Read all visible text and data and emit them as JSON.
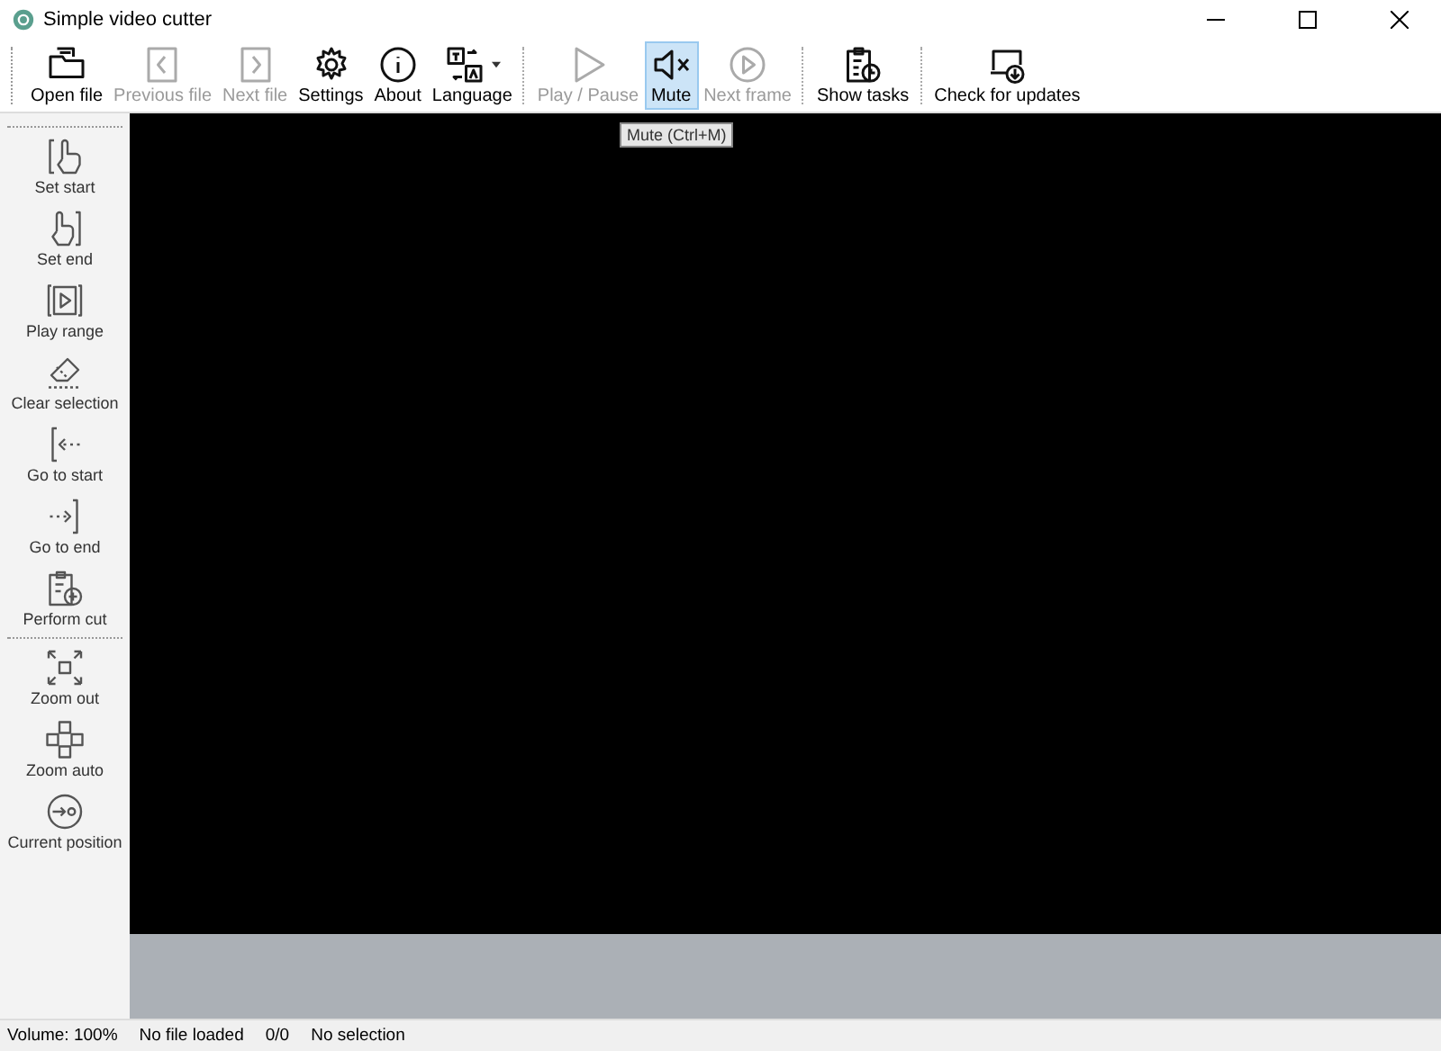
{
  "window": {
    "title": "Simple video cutter"
  },
  "toolbar": {
    "groups": [
      [
        {
          "label": "Open file",
          "kind": "open",
          "disabled": false,
          "selected": false
        },
        {
          "label": "Previous file",
          "kind": "prev",
          "disabled": true,
          "selected": false
        },
        {
          "label": "Next file",
          "kind": "next",
          "disabled": true,
          "selected": false
        },
        {
          "label": "Settings",
          "kind": "gear",
          "disabled": false,
          "selected": false
        },
        {
          "label": "About",
          "kind": "info",
          "disabled": false,
          "selected": false
        },
        {
          "label": "Language",
          "kind": "lang",
          "disabled": false,
          "selected": false,
          "dropdown": true
        }
      ],
      [
        {
          "label": "Play / Pause",
          "kind": "play",
          "disabled": true,
          "selected": false
        },
        {
          "label": "Mute",
          "kind": "mute",
          "disabled": false,
          "selected": true
        },
        {
          "label": "Next frame",
          "kind": "frame",
          "disabled": true,
          "selected": false
        }
      ],
      [
        {
          "label": "Show tasks",
          "kind": "tasks",
          "disabled": false,
          "selected": false
        }
      ],
      [
        {
          "label": "Check for updates",
          "kind": "update",
          "disabled": false,
          "selected": false
        }
      ]
    ]
  },
  "tooltip": "Mute (Ctrl+M)",
  "sidebar": {
    "groups": [
      [
        {
          "label": "Set start",
          "kind": "setstart"
        },
        {
          "label": "Set end",
          "kind": "setend"
        },
        {
          "label": "Play range",
          "kind": "range"
        },
        {
          "label": "Clear selection",
          "kind": "eraser"
        },
        {
          "label": "Go to start",
          "kind": "gostart"
        },
        {
          "label": "Go to end",
          "kind": "goend"
        },
        {
          "label": "Perform cut",
          "kind": "cut"
        }
      ],
      [
        {
          "label": "Zoom out",
          "kind": "zoomout"
        },
        {
          "label": "Zoom auto",
          "kind": "zoomauto"
        },
        {
          "label": "Current position",
          "kind": "position"
        }
      ]
    ]
  },
  "status_bar": [
    "Volume: 100%",
    "No file loaded",
    "0/0",
    "No selection"
  ]
}
